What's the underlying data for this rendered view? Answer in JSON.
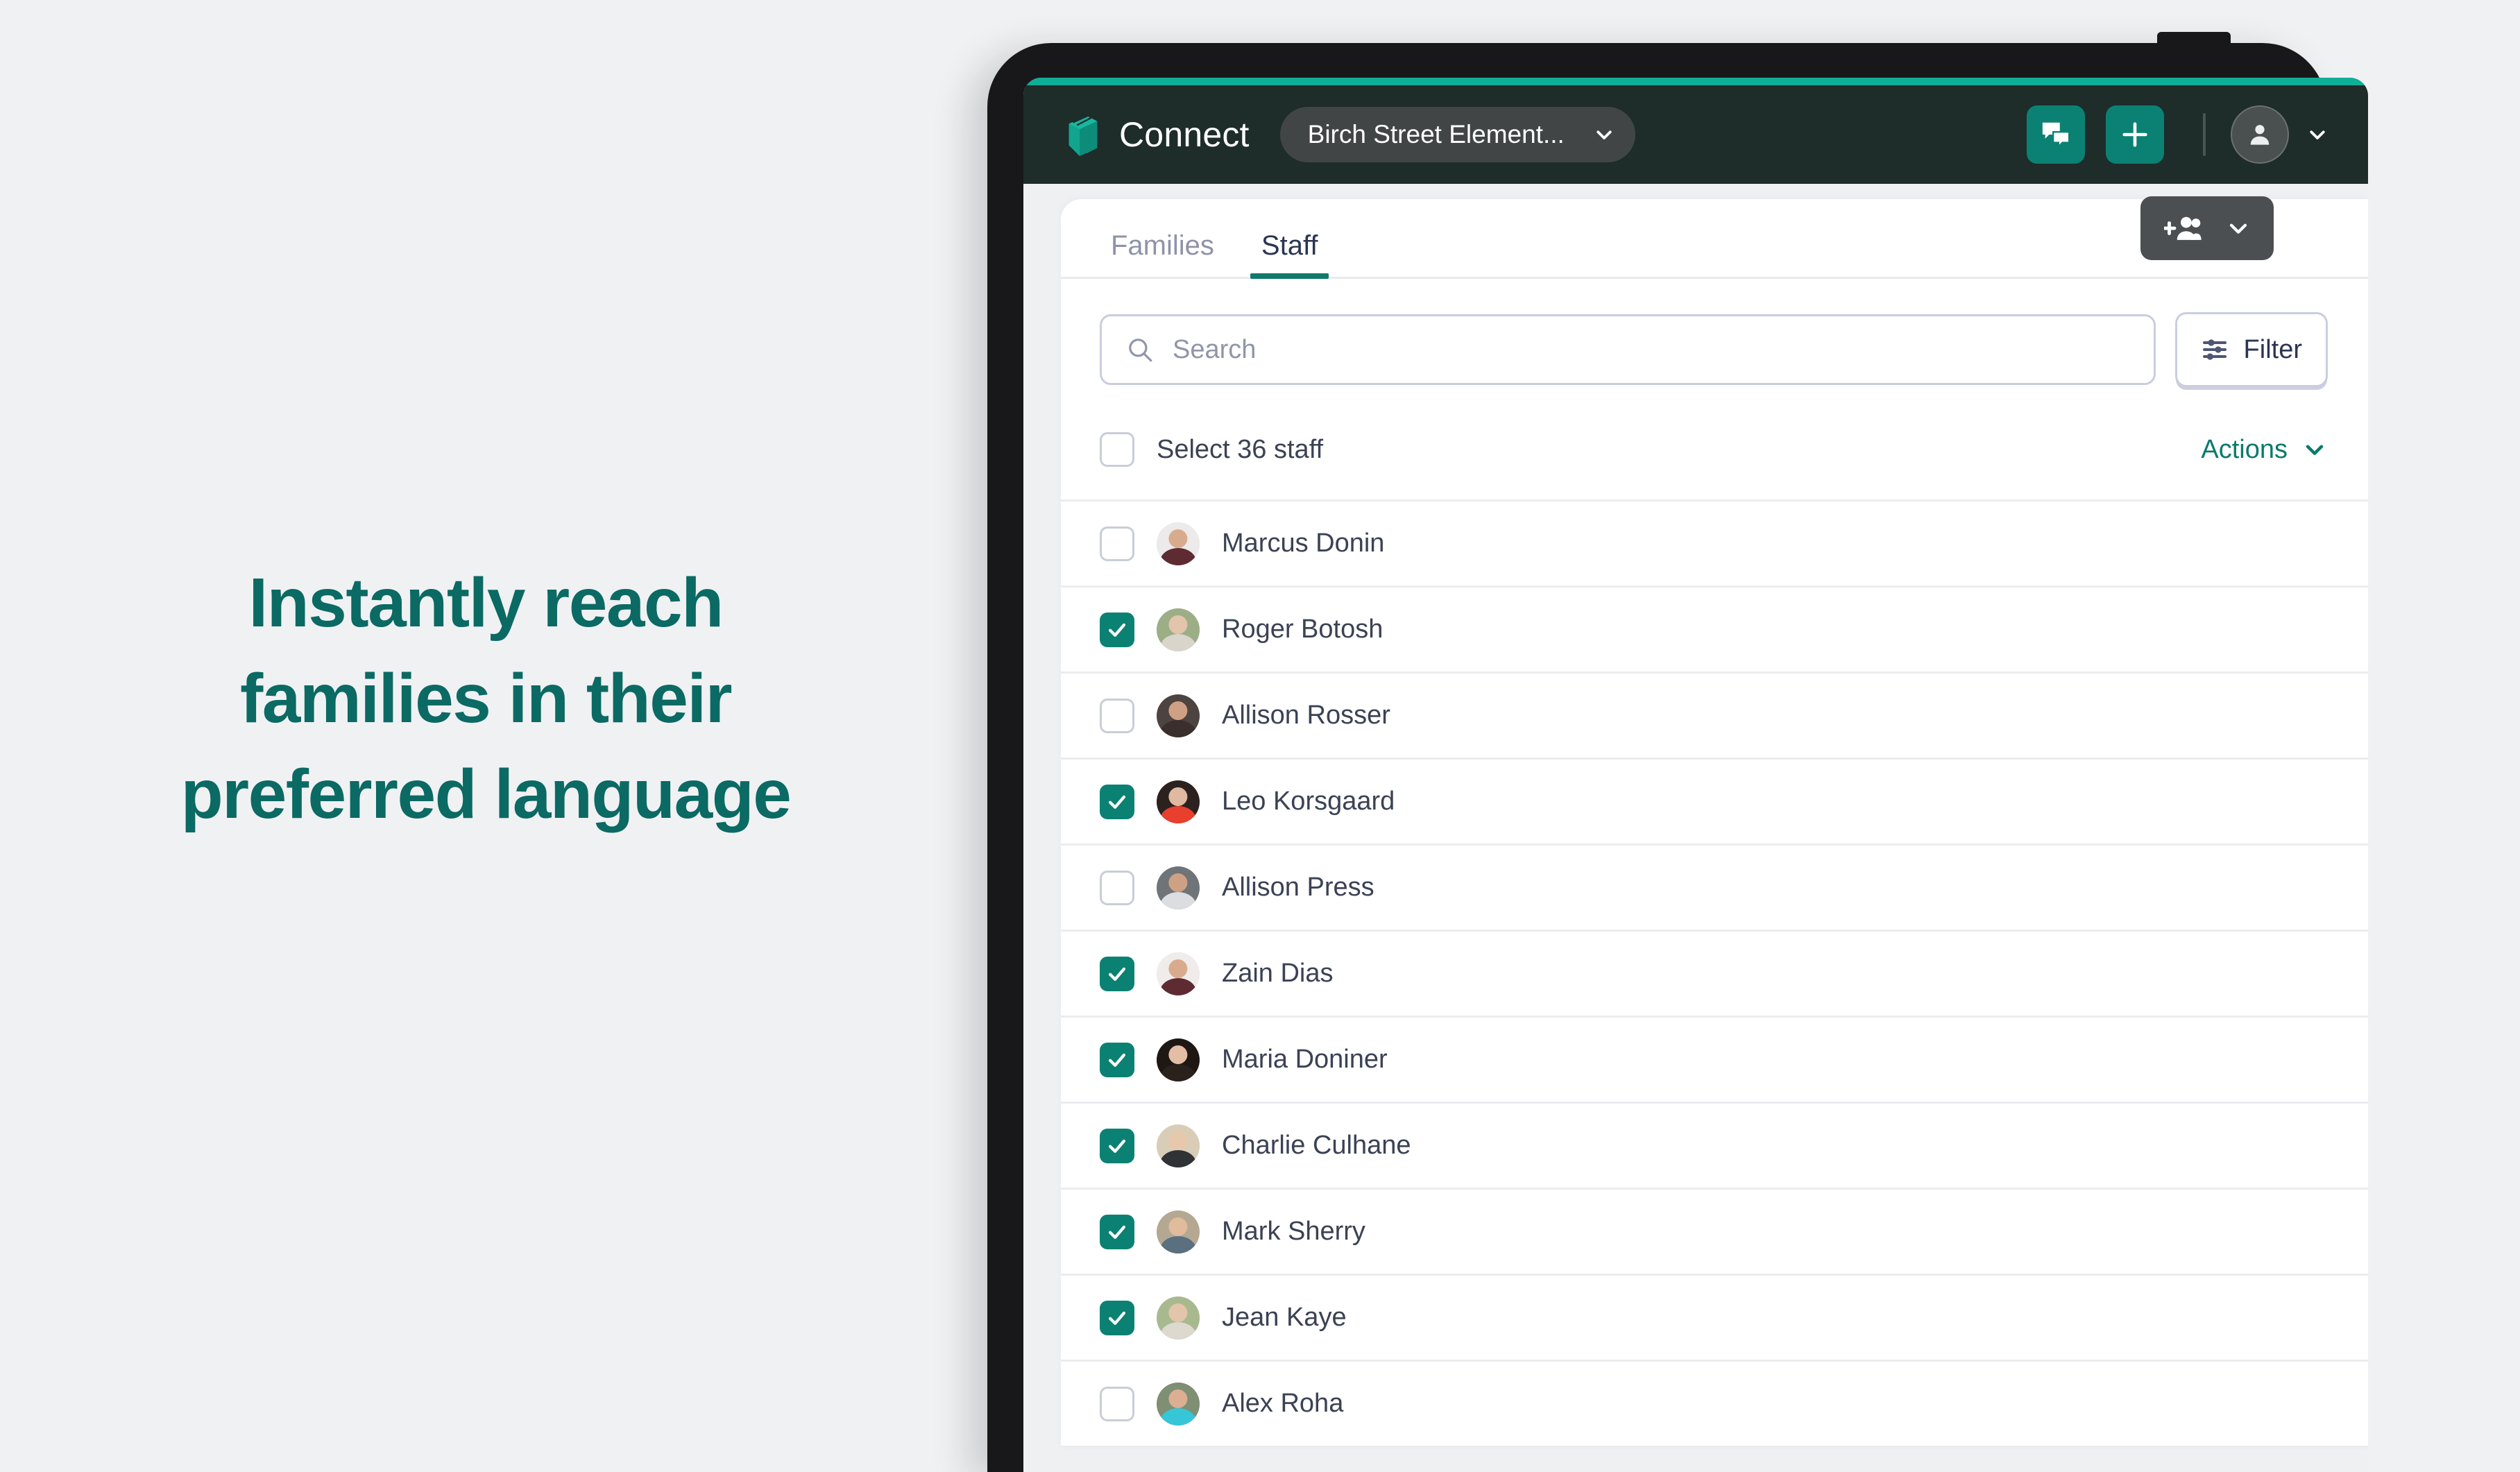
{
  "promo": {
    "lines": [
      "Instantly reach",
      "families in their",
      "preferred language"
    ],
    "color": "#0b6a63"
  },
  "app": {
    "brand_name": "Connect",
    "logo_icon": "book-icon",
    "school_selector": {
      "label": "Birch Street Element...",
      "chevron_icon": "chevron-down-icon"
    },
    "messages_button": {
      "icon": "chat-bubbles-icon"
    },
    "add_button": {
      "icon": "plus-icon"
    },
    "account": {
      "icon": "person-icon",
      "chevron_icon": "chevron-down-icon"
    },
    "accent_color": "#0fae96",
    "header_bg": "#1e2c2a"
  },
  "page": {
    "tabs": [
      {
        "label": "Families",
        "active": false
      },
      {
        "label": "Staff",
        "active": true
      }
    ],
    "add_staff_button": {
      "icon": "add-people-icon",
      "chevron_icon": "chevron-down-icon"
    },
    "search": {
      "placeholder": "Search",
      "value": "",
      "icon": "search-icon"
    },
    "filter_button": {
      "label": "Filter",
      "icon": "sliders-icon"
    },
    "select_all": {
      "label": "Select 36 staff",
      "checked": false
    },
    "actions_menu": {
      "label": "Actions",
      "chevron_icon": "chevron-down-icon",
      "color": "#0b7a6c"
    },
    "checkbox_checked_color": "#0b8173"
  },
  "staff": [
    {
      "name": "Marcus Donin",
      "checked": false,
      "bg": "#eceaea",
      "skin": "#d9ab8d",
      "shirt": "#5e2b33"
    },
    {
      "name": "Roger Botosh",
      "checked": true,
      "bg": "#9cae86",
      "skin": "#e2c5ab",
      "shirt": "#d9d5cb"
    },
    {
      "name": "Allison Rosser",
      "checked": false,
      "bg": "#4d4441",
      "skin": "#cfa184",
      "shirt": "#3a2f2c"
    },
    {
      "name": "Leo Korsgaard",
      "checked": true,
      "bg": "#2b2220",
      "skin": "#e0b9a0",
      "shirt": "#e8402c"
    },
    {
      "name": "Allison Press",
      "checked": false,
      "bg": "#6e7478",
      "skin": "#cfa184",
      "shirt": "#dcdde0"
    },
    {
      "name": "Zain Dias",
      "checked": true,
      "bg": "#efeceb",
      "skin": "#d9ab8d",
      "shirt": "#5e2b33"
    },
    {
      "name": "Maria Doniner",
      "checked": true,
      "bg": "#1e1714",
      "skin": "#e3bda4",
      "shirt": "#2a211d"
    },
    {
      "name": "Charlie Culhane",
      "checked": true,
      "bg": "#d9cdb7",
      "skin": "#e8c8ac",
      "shirt": "#2f3336"
    },
    {
      "name": "Mark Sherry",
      "checked": true,
      "bg": "#b4a893",
      "skin": "#e0bb9c",
      "shirt": "#5a6f80"
    },
    {
      "name": "Jean Kaye",
      "checked": true,
      "bg": "#a9b98f",
      "skin": "#e2c5ab",
      "shirt": "#ddd9cf"
    },
    {
      "name": "Alex Roha",
      "checked": false,
      "bg": "#7e8f74",
      "skin": "#dcae92",
      "shirt": "#35c6d8"
    }
  ]
}
